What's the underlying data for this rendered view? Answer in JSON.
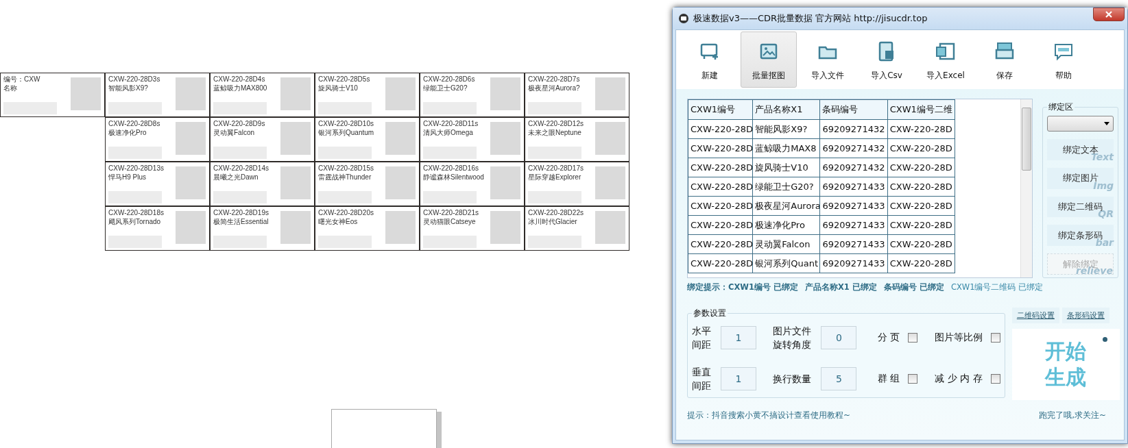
{
  "canvas": {
    "template_card": {
      "code_label": "编号：CXW",
      "name_label": "名称"
    },
    "cards": [
      {
        "code": "CXW-220-28D3s",
        "name": "智能风影X9?"
      },
      {
        "code": "CXW-220-28D4s",
        "name": "蓝鲸吸力MAX800"
      },
      {
        "code": "CXW-220-28D5s",
        "name": "旋风骑士V10"
      },
      {
        "code": "CXW-220-28D6s",
        "name": "绿能卫士G20?"
      },
      {
        "code": "CXW-220-28D7s",
        "name": "极夜星河Aurora?"
      },
      {
        "code": "CXW-220-28D8s",
        "name": "极速净化Pro"
      },
      {
        "code": "CXW-220-28D9s",
        "name": "灵动翼Falcon"
      },
      {
        "code": "CXW-220-28D10s",
        "name": "银河系列Quantum"
      },
      {
        "code": "CXW-220-28D11s",
        "name": "清风大师Omega"
      },
      {
        "code": "CXW-220-28D12s",
        "name": "未来之眼Neptune"
      },
      {
        "code": "CXW-220-28D13s",
        "name": "悍马H9 Plus"
      },
      {
        "code": "CXW-220-28D14s",
        "name": "晨曦之光Dawn"
      },
      {
        "code": "CXW-220-28D15s",
        "name": "雷霆战神Thunder"
      },
      {
        "code": "CXW-220-28D16s",
        "name": "静谧森林Silentwood"
      },
      {
        "code": "CXW-220-28D17s",
        "name": "星际穿越Explorer"
      },
      {
        "code": "CXW-220-28D18s",
        "name": "飓风系列Tornado"
      },
      {
        "code": "CXW-220-28D19s",
        "name": "极简生活Essential"
      },
      {
        "code": "CXW-220-28D20s",
        "name": "曙光女神Eos"
      },
      {
        "code": "CXW-220-28D21s",
        "name": "灵动猫眼Catseye"
      },
      {
        "code": "CXW-220-28D22s",
        "name": "冰川时代Glacier"
      }
    ]
  },
  "window": {
    "title": "极速数据v3——CDR批量数据  官方网站 http://jisucdr.top"
  },
  "toolbar": [
    {
      "label": "新建",
      "selected": false
    },
    {
      "label": "批量抠图",
      "selected": true
    },
    {
      "label": "导入文件",
      "selected": false
    },
    {
      "label": "导入Csv",
      "selected": false
    },
    {
      "label": "导入Excel",
      "selected": false
    },
    {
      "label": "保存",
      "selected": false
    },
    {
      "label": "帮助",
      "selected": false
    }
  ],
  "table": {
    "columns": [
      "CXW1编号",
      "产品名称X1",
      "条码编号",
      "CXW1编号二维"
    ],
    "rows": [
      [
        "CXW-220-28D",
        "智能风影X9?",
        "69209271432",
        "CXW-220-28D"
      ],
      [
        "CXW-220-28D",
        "蓝鲸吸力MAX8",
        "69209271432",
        "CXW-220-28D"
      ],
      [
        "CXW-220-28D",
        "旋风骑士V10",
        "69209271432",
        "CXW-220-28D"
      ],
      [
        "CXW-220-28D",
        "绿能卫士G20?",
        "69209271433",
        "CXW-220-28D"
      ],
      [
        "CXW-220-28D",
        "极夜星河Aurora",
        "69209271433",
        "CXW-220-28D"
      ],
      [
        "CXW-220-28D",
        "极速净化Pro",
        "69209271433",
        "CXW-220-28D"
      ],
      [
        "CXW-220-28D",
        "灵动翼Falcon",
        "69209271433",
        "CXW-220-28D"
      ],
      [
        "CXW-220-28D",
        "银河系列Quant",
        "69209271433",
        "CXW-220-28D"
      ]
    ]
  },
  "bind_area": {
    "legend": "绑定区",
    "buttons": [
      {
        "label": "绑定文本",
        "hint": "Text",
        "disabled": false
      },
      {
        "label": "绑定图片",
        "hint": "Img",
        "disabled": false
      },
      {
        "label": "绑定二维码",
        "hint": "QR",
        "disabled": false
      },
      {
        "label": "绑定条形码",
        "hint": "bar",
        "disabled": false
      },
      {
        "label": "解除绑定",
        "hint": "relieve",
        "disabled": true
      }
    ]
  },
  "bind_hint": [
    "绑定提示：CXW1编号 已绑定",
    "产品名称X1 已绑定",
    "条码编号 已绑定",
    "CXW1编号二维码 已绑定"
  ],
  "params": {
    "legend": "参数设置",
    "items": [
      {
        "kind": "number",
        "label_lines": [
          "水平",
          "间距"
        ],
        "value": "1"
      },
      {
        "kind": "number",
        "label_lines": [
          "图片文件",
          "旋转角度"
        ],
        "value": "0"
      },
      {
        "kind": "checkbox",
        "label": "分 页",
        "checked": false
      },
      {
        "kind": "checkbox",
        "label": "图片等比例",
        "checked": false
      },
      {
        "kind": "number",
        "label_lines": [
          "垂直",
          "间距"
        ],
        "value": "1"
      },
      {
        "kind": "number",
        "label_lines": [
          "换行数量"
        ],
        "value": "5"
      },
      {
        "kind": "checkbox",
        "label": "群 组",
        "checked": false
      },
      {
        "kind": "checkbox",
        "label": "减 少 内 存",
        "checked": false
      }
    ]
  },
  "links": [
    "二维码设置",
    "条形码设置"
  ],
  "start_button": {
    "lines": [
      "开始",
      "生成"
    ]
  },
  "status": {
    "tip": "提示：抖音搜索小黄不搞设计查看使用教程~",
    "note": "跑完了哦,求关注~"
  }
}
